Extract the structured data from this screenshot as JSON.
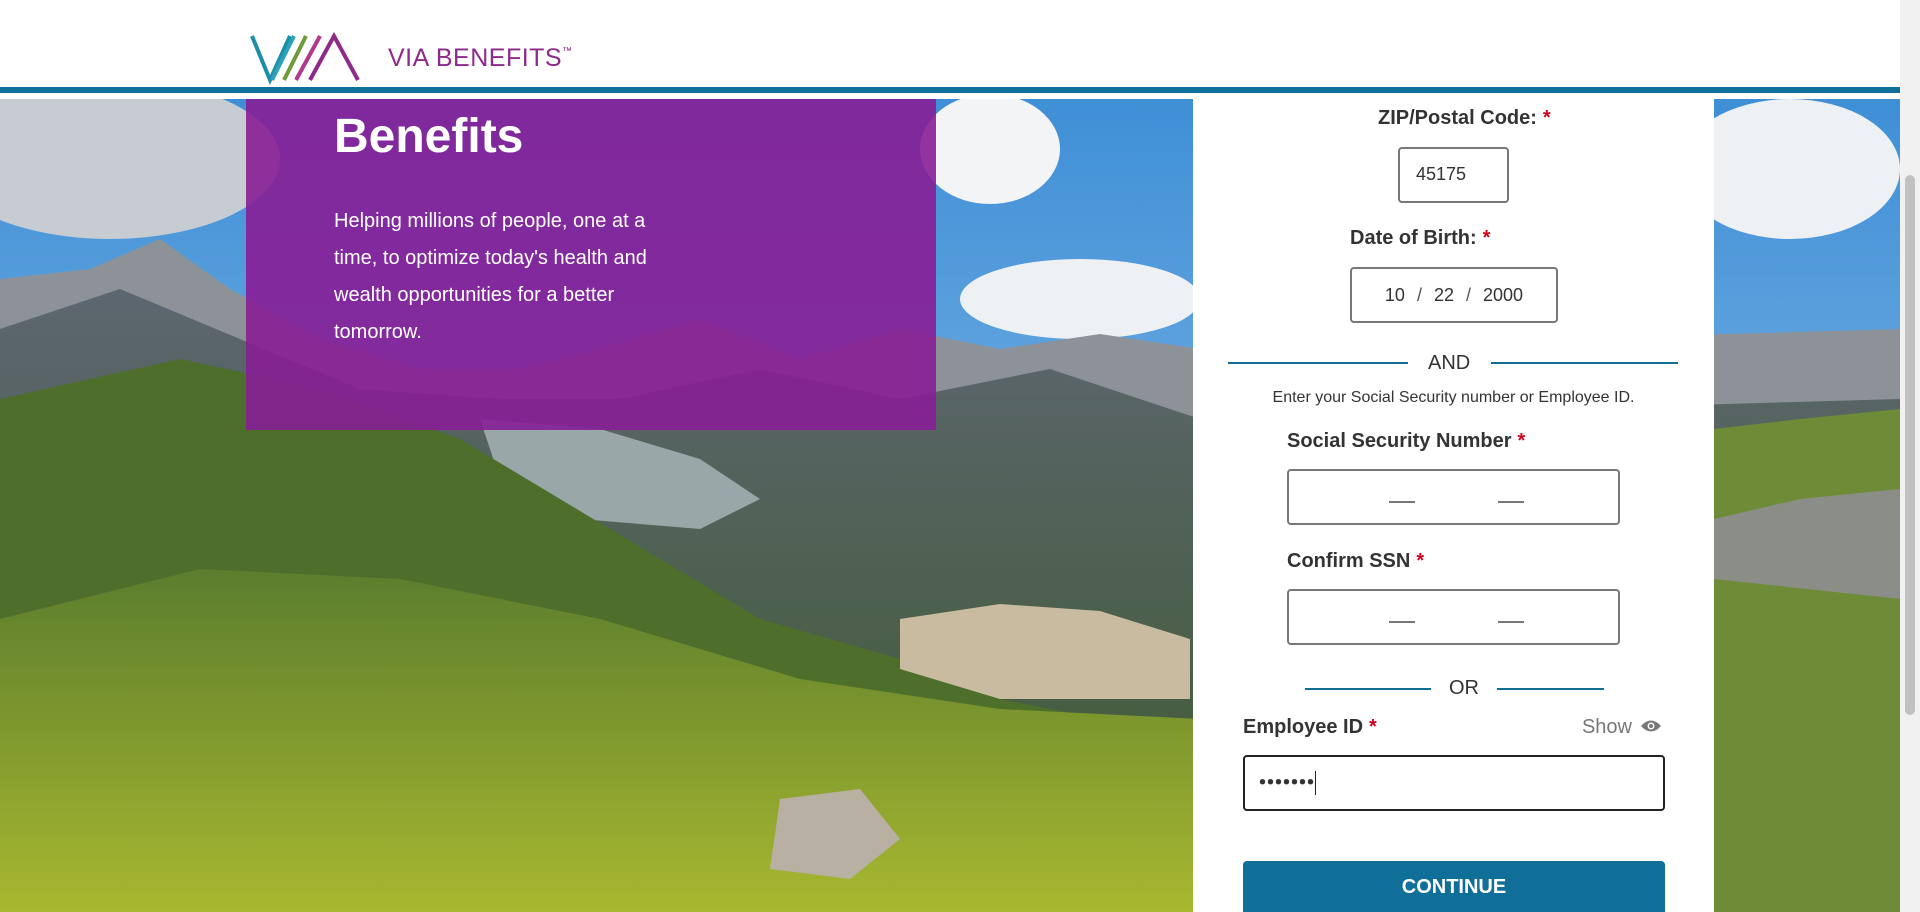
{
  "header": {
    "logo_text": "VIA BENEFITS",
    "logo_tm": "™"
  },
  "hero": {
    "title": "Benefits",
    "body": "Helping millions of people, one at a time, to optimize today's health and wealth opportunities for a better tomorrow."
  },
  "form": {
    "zip_label": "ZIP/Postal Code:",
    "zip_value": "45175",
    "dob_label": "Date of Birth:",
    "dob_month": "10",
    "dob_day": "22",
    "dob_year": "2000",
    "dob_separator": "/",
    "and_text": "AND",
    "hint": "Enter your Social Security number or Employee ID.",
    "ssn_label": "Social Security Number",
    "confirm_ssn_label": "Confirm SSN",
    "or_text": "OR",
    "employee_id_label": "Employee ID",
    "show_label": "Show",
    "employee_id_value": "•••••••",
    "required_marker": "*",
    "continue_label": "CONTINUE"
  },
  "colors": {
    "brand_purple": "#871e96",
    "brand_blue": "#0f6f99",
    "required_red": "#d0021b"
  },
  "icons": {
    "logo": "via-benefits-logo",
    "show": "eye-icon"
  }
}
